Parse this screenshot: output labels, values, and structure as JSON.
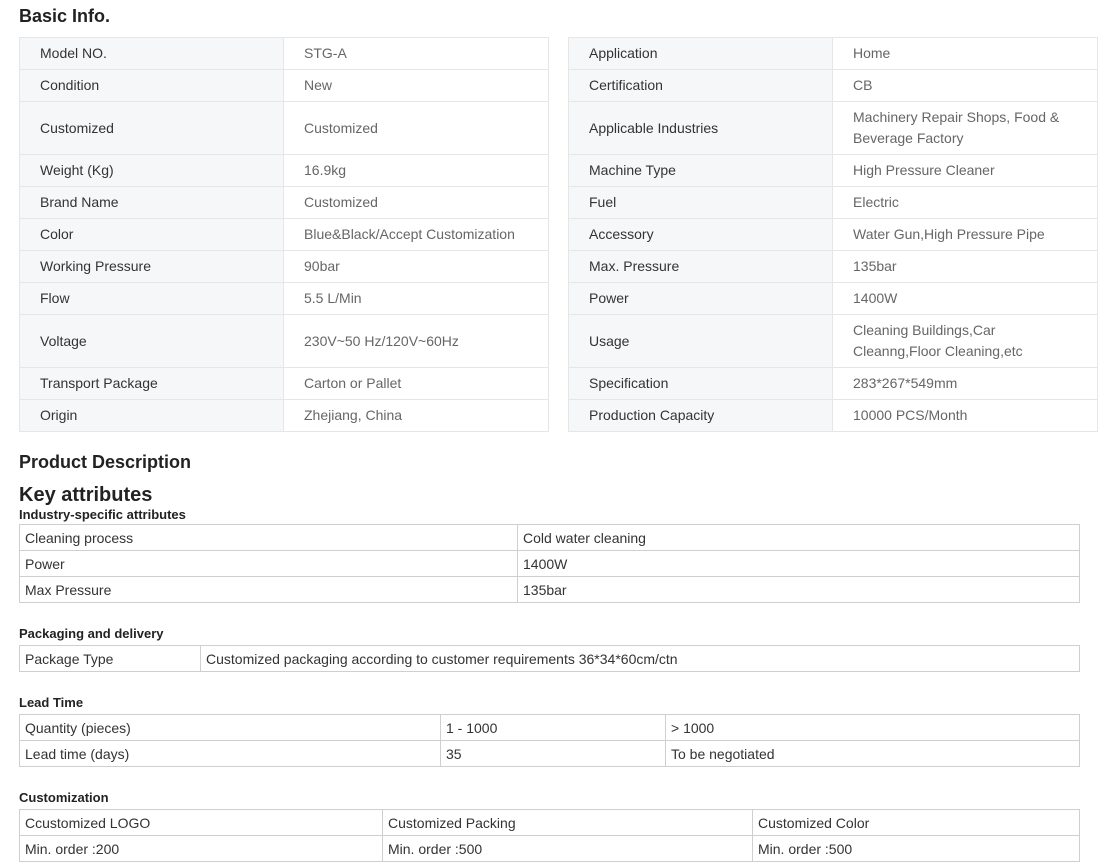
{
  "basic_info": {
    "title": "Basic Info.",
    "left": [
      {
        "label": "Model NO.",
        "value": "STG-A"
      },
      {
        "label": "Condition",
        "value": "New"
      },
      {
        "label": "Customized",
        "value": "Customized"
      },
      {
        "label": "Weight (Kg)",
        "value": "16.9kg"
      },
      {
        "label": "Brand Name",
        "value": "Customized"
      },
      {
        "label": "Color",
        "value": "Blue&Black/Accept Customization"
      },
      {
        "label": "Working Pressure",
        "value": "90bar"
      },
      {
        "label": "Flow",
        "value": "5.5 L/Min"
      },
      {
        "label": "Voltage",
        "value": "230V~50 Hz/120V~60Hz"
      },
      {
        "label": "Transport Package",
        "value": "Carton or Pallet"
      },
      {
        "label": "Origin",
        "value": "Zhejiang, China"
      }
    ],
    "right": [
      {
        "label": "Application",
        "value": "Home"
      },
      {
        "label": "Certification",
        "value": "CB"
      },
      {
        "label": "Applicable Industries",
        "value": "Machinery Repair Shops, Food & Beverage Factory"
      },
      {
        "label": "Machine Type",
        "value": "High Pressure Cleaner"
      },
      {
        "label": "Fuel",
        "value": "Electric"
      },
      {
        "label": "Accessory",
        "value": "Water Gun,High Pressure Pipe"
      },
      {
        "label": "Max. Pressure",
        "value": "135bar"
      },
      {
        "label": "Power",
        "value": "1400W"
      },
      {
        "label": "Usage",
        "value": "Cleaning Buildings,Car Cleanng,Floor Cleaning,etc"
      },
      {
        "label": "Specification",
        "value": "283*267*549mm"
      },
      {
        "label": "Production Capacity",
        "value": "10000 PCS/Month"
      }
    ]
  },
  "product_description": {
    "title": "Product Description",
    "key_attributes_title": "Key attributes",
    "industry": {
      "title": "Industry-specific attributes",
      "rows": [
        [
          "Cleaning process",
          "Cold water cleaning"
        ],
        [
          "Power",
          "1400W"
        ],
        [
          "Max Pressure",
          "135bar"
        ]
      ]
    },
    "packaging": {
      "title": "Packaging and delivery",
      "rows": [
        [
          "Package Type",
          "Customized packaging according to customer requirements 36*34*60cm/ctn"
        ]
      ]
    },
    "lead_time": {
      "title": "Lead Time",
      "rows": [
        [
          "Quantity (pieces)",
          "1 - 1000",
          "> 1000"
        ],
        [
          "Lead time (days)",
          "35",
          "To be negotiated"
        ]
      ]
    },
    "customization": {
      "title": "Customization",
      "rows": [
        [
          "Ccustomized LOGO",
          "Customized Packing",
          "Customized Color"
        ],
        [
          "Min. order :200",
          "Min. order :500",
          "Min. order :500"
        ]
      ]
    }
  }
}
